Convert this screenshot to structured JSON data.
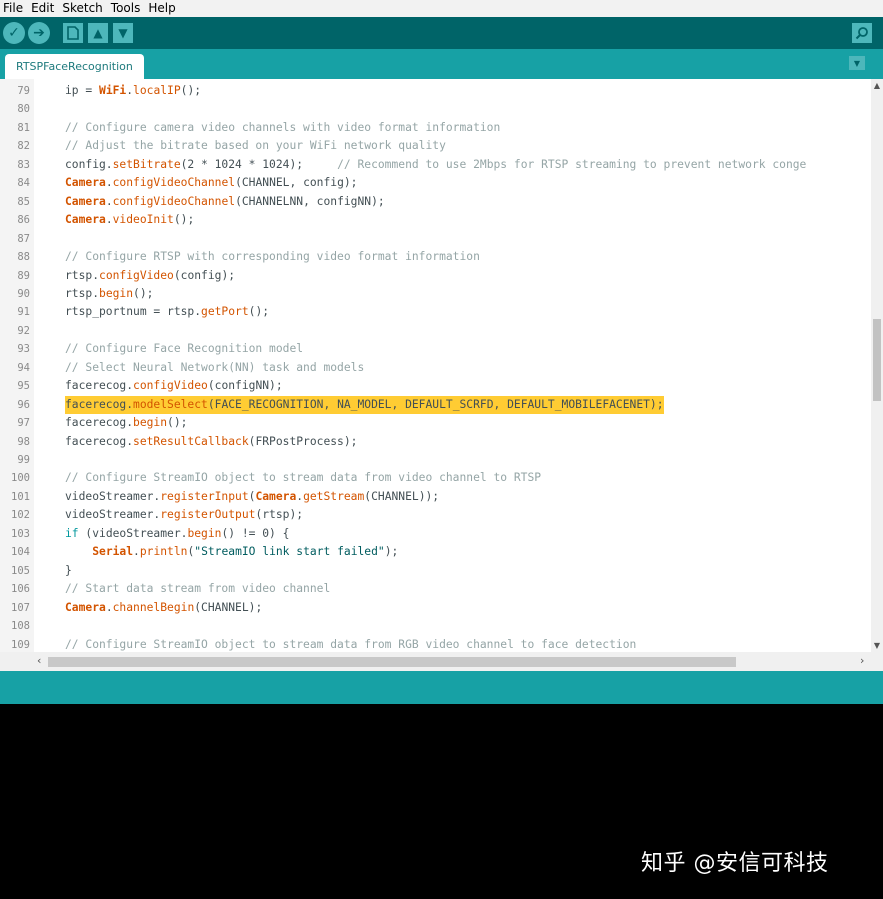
{
  "menu": [
    "File",
    "Edit",
    "Sketch",
    "Tools",
    "Help"
  ],
  "toolbar": {
    "verify_icon": "check-icon",
    "upload_icon": "arrow-right-icon",
    "new_icon": "file-icon",
    "open_icon": "arrow-up-icon",
    "save_icon": "arrow-down-icon",
    "serial_icon": "magnifier-icon"
  },
  "tab": {
    "label": "RTSPFaceRecognition"
  },
  "editor": {
    "lines": [
      {
        "num": "79",
        "code": "ip = WiFi.localIP();"
      },
      {
        "num": "80",
        "code": ""
      },
      {
        "num": "81",
        "code": "// Configure camera video channels with video format information"
      },
      {
        "num": "82",
        "code": "// Adjust the bitrate based on your WiFi network quality"
      },
      {
        "num": "83",
        "code": "config.setBitrate(2 * 1024 * 1024);     // Recommend to use 2Mbps for RTSP streaming to prevent network conge"
      },
      {
        "num": "84",
        "code": "Camera.configVideoChannel(CHANNEL, config);"
      },
      {
        "num": "85",
        "code": "Camera.configVideoChannel(CHANNELNN, configNN);"
      },
      {
        "num": "86",
        "code": "Camera.videoInit();"
      },
      {
        "num": "87",
        "code": ""
      },
      {
        "num": "88",
        "code": "// Configure RTSP with corresponding video format information"
      },
      {
        "num": "89",
        "code": "rtsp.configVideo(config);"
      },
      {
        "num": "90",
        "code": "rtsp.begin();"
      },
      {
        "num": "91",
        "code": "rtsp_portnum = rtsp.getPort();"
      },
      {
        "num": "92",
        "code": ""
      },
      {
        "num": "93",
        "code": "// Configure Face Recognition model"
      },
      {
        "num": "94",
        "code": "// Select Neural Network(NN) task and models"
      },
      {
        "num": "95",
        "code": "facerecog.configVideo(configNN);"
      },
      {
        "num": "96",
        "code": "facerecog.modelSelect(FACE_RECOGNITION, NA_MODEL, DEFAULT_SCRFD, DEFAULT_MOBILEFACENET);"
      },
      {
        "num": "97",
        "code": "facerecog.begin();"
      },
      {
        "num": "98",
        "code": "facerecog.setResultCallback(FRPostProcess);"
      },
      {
        "num": "99",
        "code": ""
      },
      {
        "num": "100",
        "code": "// Configure StreamIO object to stream data from video channel to RTSP"
      },
      {
        "num": "101",
        "code": "videoStreamer.registerInput(Camera.getStream(CHANNEL));"
      },
      {
        "num": "102",
        "code": "videoStreamer.registerOutput(rtsp);"
      },
      {
        "num": "103",
        "code": "if (videoStreamer.begin() != 0) {"
      },
      {
        "num": "104",
        "code": "    Serial.println(\"StreamIO link start failed\");"
      },
      {
        "num": "105",
        "code": "}"
      },
      {
        "num": "106",
        "code": "// Start data stream from video channel"
      },
      {
        "num": "107",
        "code": "Camera.channelBegin(CHANNEL);"
      },
      {
        "num": "108",
        "code": ""
      },
      {
        "num": "109",
        "code": "// Configure StreamIO object to stream data from RGB video channel to face detection"
      }
    ],
    "highlighted_line": "96"
  },
  "watermark": "知乎 @安信可科技",
  "colors": {
    "toolbar": "#006468",
    "tabbar": "#17a1a5",
    "button": "#4db7bb",
    "highlight": "#ffcc33",
    "function": "#d35400",
    "keyword": "#00979c",
    "comment": "#95a5a6"
  }
}
